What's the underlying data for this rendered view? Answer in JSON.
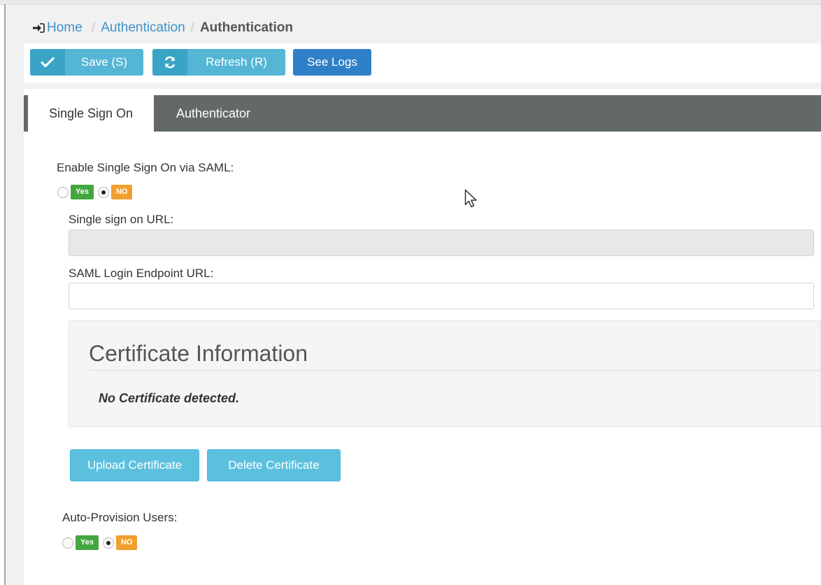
{
  "breadcrumb": {
    "home": "Home",
    "section": "Authentication",
    "current": "Authentication"
  },
  "toolbar": {
    "save_label": "Save (S)",
    "refresh_label": "Refresh (R)",
    "logs_label": "See Logs"
  },
  "tabs": [
    {
      "label": "Single Sign On",
      "active": true
    },
    {
      "label": "Authenticator",
      "active": false
    }
  ],
  "sso": {
    "enable_label": "Enable Single Sign On via SAML:",
    "yes_label": "Yes",
    "no_label": "NO",
    "selected": "NO",
    "sso_url_label": "Single sign on URL:",
    "sso_url_value": "",
    "saml_endpoint_label": "SAML Login Endpoint URL:",
    "saml_endpoint_value": ""
  },
  "certificate": {
    "title": "Certificate Information",
    "message": "No Certificate detected.",
    "upload_label": "Upload Certificate",
    "delete_label": "Delete Certificate"
  },
  "auto_provision": {
    "label": "Auto-Provision Users:",
    "yes_label": "Yes",
    "no_label": "NO",
    "selected": "NO"
  },
  "icons": {
    "home": "sign-in-icon",
    "save": "check-icon",
    "refresh": "refresh-icon"
  },
  "colors": {
    "primary_button": "#54b5d5",
    "logs_button": "#2f80c8",
    "tab_bar": "#636869",
    "yes_tag": "#43a63f",
    "no_tag": "#f0a02f",
    "link": "#3f92c9"
  }
}
